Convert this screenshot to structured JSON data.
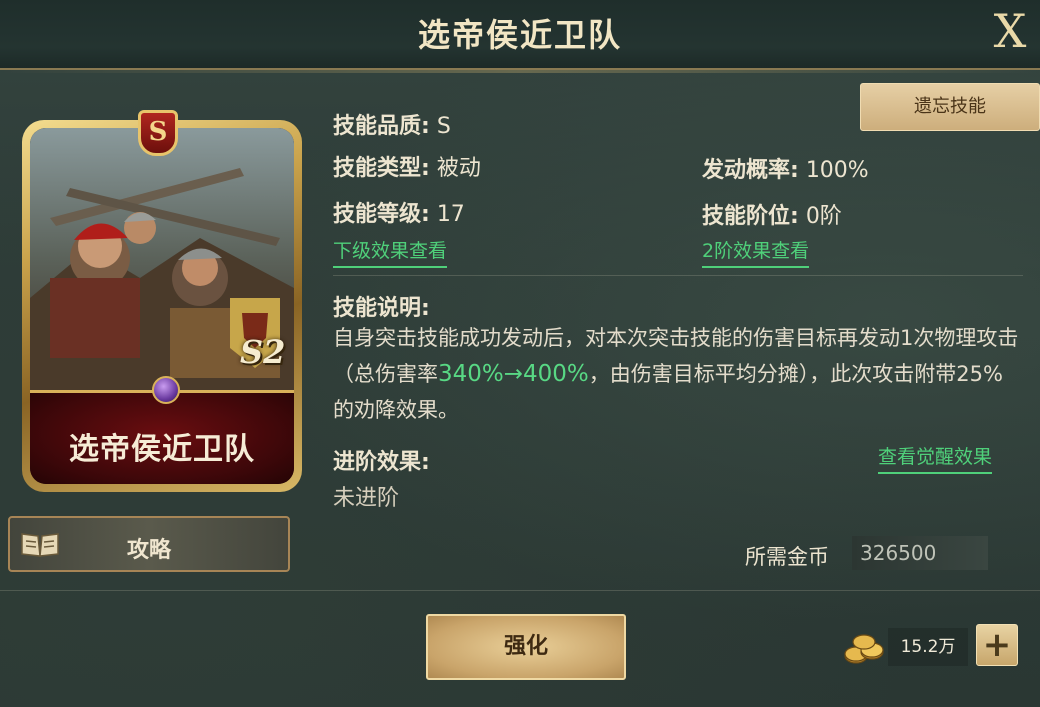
{
  "header": {
    "title": "选帝侯近卫队",
    "close_label": "X"
  },
  "card": {
    "rank": "S",
    "season": "S2",
    "name": "选帝侯近卫队"
  },
  "guide": {
    "label": "攻略"
  },
  "forget_button": {
    "label": "遗忘技能"
  },
  "skill": {
    "quality_label": "技能品质:",
    "quality_value": "S",
    "type_label": "技能类型:",
    "type_value": "被动",
    "level_label": "技能等级:",
    "level_value": "17",
    "trigger_label": "发动概率:",
    "trigger_value": "100%",
    "tier_label": "技能阶位:",
    "tier_value": "0阶",
    "next_level_link": "下级效果查看",
    "tier2_link": "2阶效果查看",
    "desc_title": "技能说明:",
    "desc_part1": "自身突击技能成功发动后，对本次突击技能的伤害目标再发动1次物理攻击（总伤害率",
    "desc_highlight": "340%→400%",
    "desc_part2": "，由伤害目标平均分摊），此次攻击附带25%的劝降效果。",
    "advance_title": "进阶效果:",
    "advance_value": "未进阶",
    "awaken_link": "查看觉醒效果"
  },
  "cost": {
    "label": "所需金币",
    "value": "326500"
  },
  "upgrade": {
    "label": "强化"
  },
  "currency": {
    "amount": "15.2万",
    "plus_label": "+"
  },
  "colors": {
    "accent_gold": "#c9a24b",
    "link_green": "#4fd07a",
    "highlight_green": "#58d884"
  }
}
